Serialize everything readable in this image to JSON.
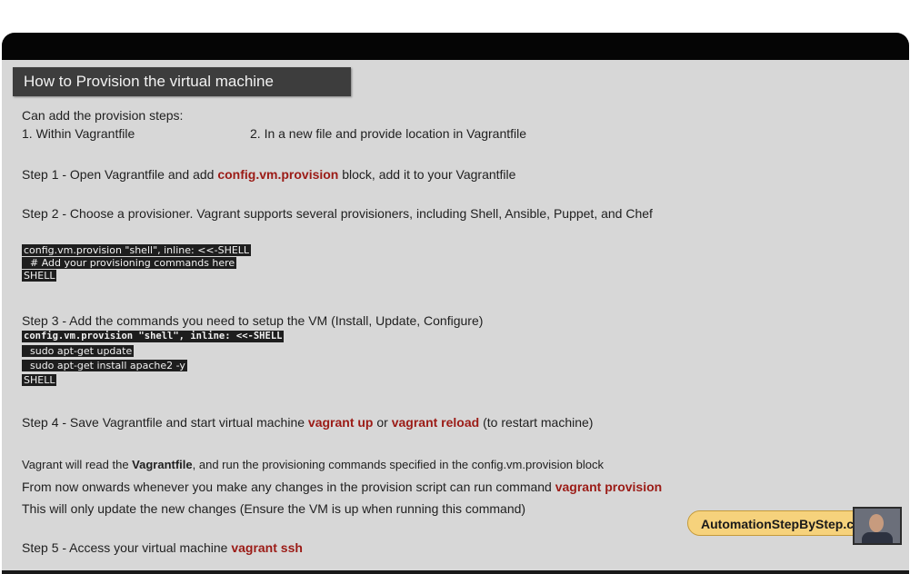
{
  "title": "How to  Provision the virtual machine",
  "intro": {
    "line1": "Can add the provision steps:",
    "opt1": "1. Within Vagrantfile",
    "opt2": "2. In a new file and provide location in Vagrantfile"
  },
  "step1": {
    "prefix": "Step 1 - Open Vagrantfile and add ",
    "highlight": "config.vm.provision",
    "suffix": " block, add it to your Vagrantfile"
  },
  "step2": {
    "text": "Step 2 - Choose a provisioner. Vagrant supports several provisioners, including Shell, Ansible, Puppet, and Chef",
    "code": [
      "config.vm.provision \"shell\", inline: <<-SHELL",
      "  # Add your provisioning commands here",
      "SHELL"
    ]
  },
  "step3": {
    "text": "Step 3 - Add the commands you need to setup the VM (Install, Update, Configure)",
    "code": [
      "config.vm.provision \"shell\", inline: <<-SHELL",
      "  sudo apt-get update",
      "  sudo apt-get install apache2 -y",
      "SHELL"
    ]
  },
  "step4": {
    "prefix": "Step 4 - Save Vagrantfile and start virtual machine ",
    "cmd1": "vagrant up",
    "middle": " or ",
    "cmd2": "vagrant reload",
    "suffix": " (to restart machine)"
  },
  "notes": {
    "l1_prefix": "Vagrant will read the ",
    "l1_bold": "Vagrantfile",
    "l1_suffix": ", and run the provisioning commands specified in the config.vm.provision block",
    "l2_prefix": "From now onwards whenever you make any changes in the provision script can run command ",
    "l2_cmd": "vagrant provision",
    "l3": "This will only update the new changes (Ensure the VM is up when running this command)"
  },
  "step5": {
    "prefix": "Step 5 - Access your virtual machine ",
    "cmd": "vagrant ssh"
  },
  "badge": "AutomationStepByStep.com",
  "colors": {
    "accent_red": "#9b1b16",
    "background": "#d7d7d7",
    "title_bg": "#3d3d3d"
  }
}
